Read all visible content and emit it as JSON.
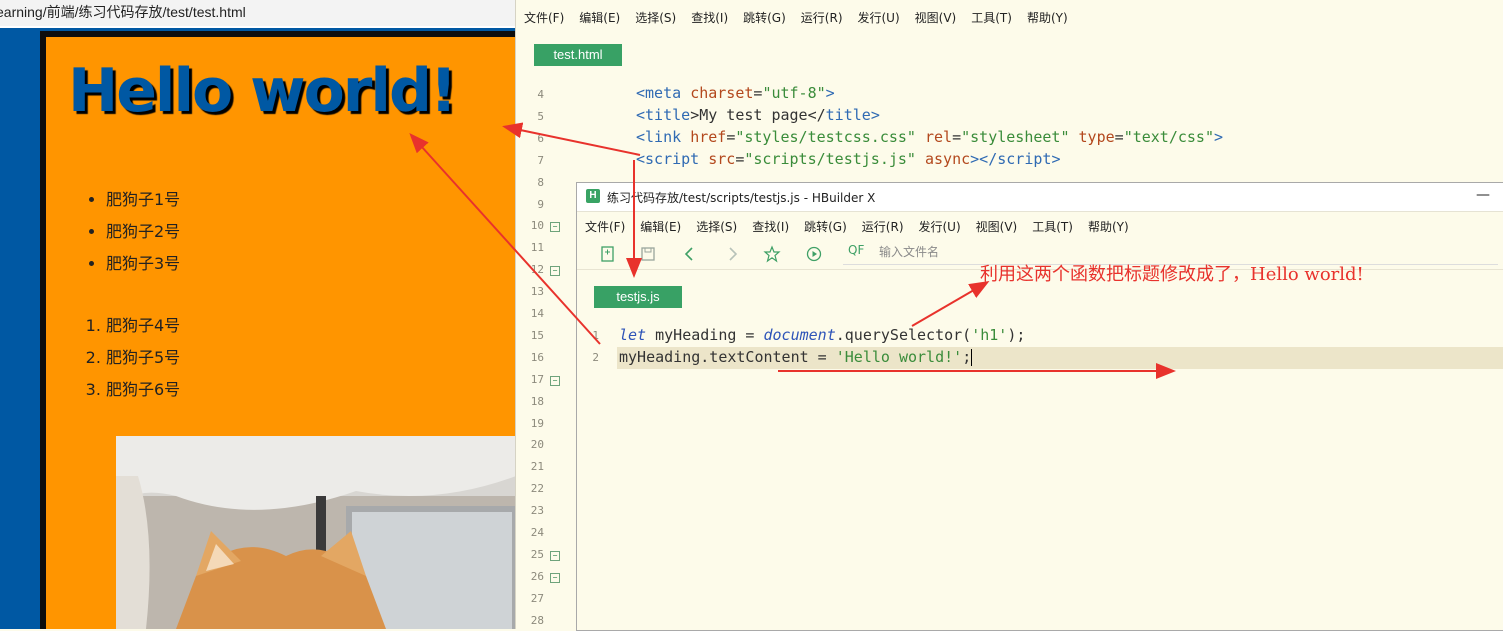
{
  "browser": {
    "address": "earning/前端/练习代码存放/test/test.html",
    "heading": "Hello world!",
    "unordered_list": [
      "肥狗子1号",
      "肥狗子2号",
      "肥狗子3号"
    ],
    "ordered_list": [
      "肥狗子4号",
      "肥狗子5号",
      "肥狗子6号"
    ]
  },
  "editor_back": {
    "menu": [
      "文件(F)",
      "编辑(E)",
      "选择(S)",
      "查找(I)",
      "跳转(G)",
      "运行(R)",
      "发行(U)",
      "视图(V)",
      "工具(T)",
      "帮助(Y)"
    ],
    "tab": "test.html",
    "line_numbers": [
      "4",
      "5",
      "6",
      "7",
      "8",
      "9",
      "10",
      "11",
      "12",
      "13",
      "14",
      "15",
      "16",
      "17",
      "18",
      "19",
      "20",
      "21",
      "22",
      "23",
      "24",
      "25",
      "26",
      "27",
      "28"
    ],
    "fold_lines": [
      "10",
      "12",
      "17",
      "25",
      "26"
    ],
    "code": {
      "line4": {
        "open": "<",
        "tag": "meta",
        "attr": "charset",
        "eq": "=",
        "val": "\"utf-8\"",
        "close": ">"
      },
      "line5": {
        "open": "<",
        "tag": "title",
        "mid": ">My test page</",
        "tag2": "title",
        "close": ">"
      },
      "line6": {
        "open": "<",
        "tag": "link",
        "attr1": "href",
        "val1": "\"styles/testcss.css\"",
        "attr2": "rel",
        "val2": "\"stylesheet\"",
        "attr3": "type",
        "val3": "\"text/css\"",
        "close": ">"
      },
      "line7": {
        "open": "<",
        "tag": "script",
        "attr1": "src",
        "val1": "\"scripts/testjs.js\"",
        "attr2": "async",
        "mid": "></",
        "tag2": "script",
        "close": ">"
      }
    }
  },
  "editor_front": {
    "title": "练习代码存放/test/scripts/testjs.js - HBuilder X",
    "logo": "H",
    "minimize": "—",
    "menu": [
      "文件(F)",
      "编辑(E)",
      "选择(S)",
      "查找(I)",
      "跳转(G)",
      "运行(R)",
      "发行(U)",
      "视图(V)",
      "工具(T)",
      "帮助(Y)"
    ],
    "search_placeholder": "输入文件名",
    "search_icon_text": "QF",
    "tab": "testjs.js",
    "line_numbers": [
      "1",
      "2"
    ],
    "code": {
      "l1_kw": "let",
      "l1_var": " myHeading = ",
      "l1_obj": "document",
      "l1_call": ".querySelector(",
      "l1_str": "'h1'",
      "l1_end": ");",
      "l2_a": "myHeading.textContent = ",
      "l2_str": "'Hello world!'",
      "l2_end": ";"
    }
  },
  "annotation": "利用这两个函数把标题修改成了，Hello world!",
  "colors": {
    "browser_bg": "#0058a3",
    "page_orange": "#ff9500",
    "tab_green": "#38a165",
    "annotation_red": "#e8322c"
  }
}
